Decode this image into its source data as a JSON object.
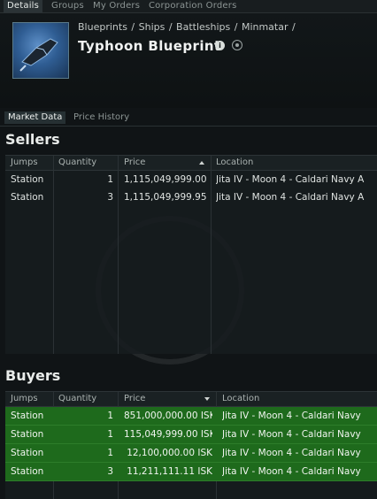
{
  "top_tabs": [
    "Details",
    "Groups",
    "My Orders",
    "Corporation Orders"
  ],
  "header": {
    "breadcrumb": "Blueprints / Ships / Battleships / Minmatar /",
    "title": "Typhoon Blueprint",
    "info_icon_glyph": "i"
  },
  "sub_tabs": [
    "Market Data",
    "Price History"
  ],
  "sellers": {
    "title": "Sellers",
    "columns": [
      "Jumps",
      "Quantity",
      "Price",
      "Location"
    ],
    "rows": [
      {
        "jumps": "Station",
        "quantity": "1",
        "price": "1,115,049,999.00 I",
        "location": "Jita IV - Moon 4 - Caldari Navy A"
      },
      {
        "jumps": "Station",
        "quantity": "3",
        "price": "1,115,049,999.95 I",
        "location": "Jita IV - Moon 4 - Caldari Navy A"
      }
    ]
  },
  "buyers": {
    "title": "Buyers",
    "columns": [
      "Jumps",
      "Quantity",
      "Price",
      "Location"
    ],
    "rows": [
      {
        "jumps": "Station",
        "quantity": "1",
        "price": "851,000,000.00 ISK",
        "location": "Jita IV - Moon 4 - Caldari Navy"
      },
      {
        "jumps": "Station",
        "quantity": "1",
        "price": "115,049,999.00 ISK",
        "location": "Jita IV - Moon 4 - Caldari Navy"
      },
      {
        "jumps": "Station",
        "quantity": "1",
        "price": "12,100,000.00 ISK",
        "location": "Jita IV - Moon 4 - Caldari Navy"
      },
      {
        "jumps": "Station",
        "quantity": "3",
        "price": "11,211,111.11 ISK",
        "location": "Jita IV - Moon 4 - Caldari Navy"
      }
    ]
  },
  "colors": {
    "buy_row": "#1e6a1c",
    "background": "#101416"
  }
}
